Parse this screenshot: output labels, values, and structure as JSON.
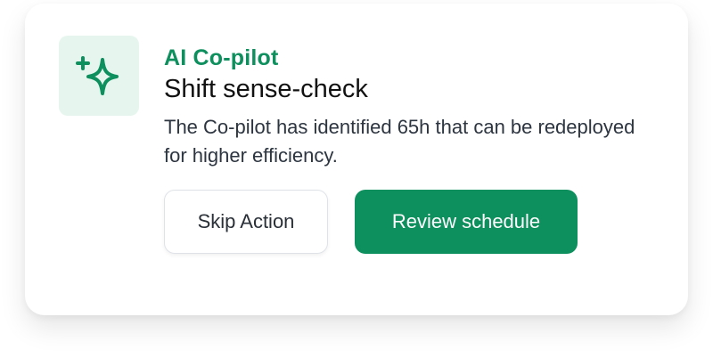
{
  "card": {
    "icon": "sparkle-icon",
    "eyebrow": "AI Co-pilot",
    "title": "Shift sense-check",
    "description": "The Co-pilot has identified 65h that can be redeployed for higher efficiency.",
    "secondary_action_label": "Skip Action",
    "primary_action_label": "Review schedule"
  },
  "colors": {
    "accent": "#0e8f5e",
    "icon_tile_bg": "#e6f6ee",
    "text_primary": "#111111",
    "text_secondary": "#2d3540"
  }
}
